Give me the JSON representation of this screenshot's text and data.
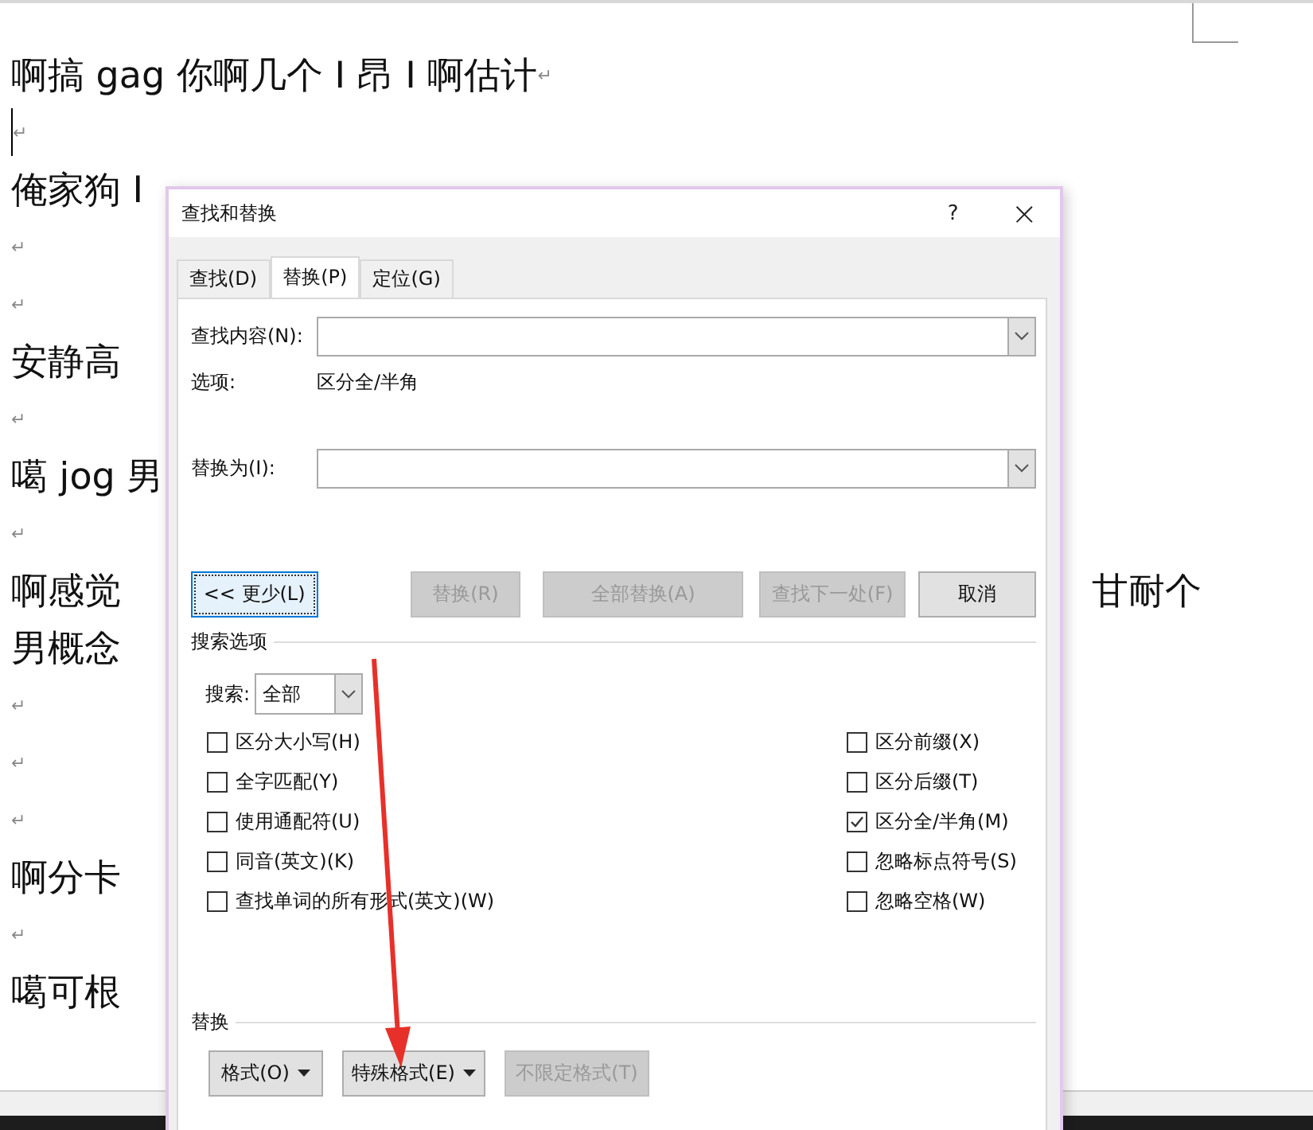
{
  "document": {
    "lines": [
      {
        "text": "啊搞 gag 你啊几个 I 昂 I 啊估计",
        "mark": "↵"
      },
      {
        "mark": "↵",
        "cursor": true
      },
      {
        "text": "俺家狗 I"
      },
      {
        "mark": "↵"
      },
      {
        "mark": "↵"
      },
      {
        "text": "安静高"
      },
      {
        "mark": "↵"
      },
      {
        "text": "噶 jog 男"
      },
      {
        "mark": "↵"
      },
      {
        "text": "啊感觉",
        "right": "甘耐个"
      },
      {
        "text": "男概念"
      },
      {
        "mark": "↵"
      },
      {
        "mark": "↵"
      },
      {
        "mark": "↵"
      },
      {
        "text": "啊分卡"
      },
      {
        "mark": "↵"
      },
      {
        "text": "噶可根"
      }
    ]
  },
  "dialog": {
    "title": "查找和替换",
    "help": "?",
    "close": "×",
    "tabs": [
      {
        "label": "查找(D)",
        "selected": false
      },
      {
        "label": "替换(P)",
        "selected": true
      },
      {
        "label": "定位(G)",
        "selected": false
      }
    ],
    "find": {
      "label": "查找内容(N):"
    },
    "options": {
      "label": "选项:",
      "value": "区分全/半角"
    },
    "replace": {
      "label": "替换为(I):"
    },
    "buttons": [
      {
        "label": "<< 更少(L)",
        "disabled": false,
        "focused": true
      },
      {
        "label": "替换(R)",
        "disabled": true,
        "focused": false
      },
      {
        "label": "全部替换(A)",
        "disabled": true,
        "focused": false
      },
      {
        "label": "查找下一处(F)",
        "disabled": true,
        "focused": false
      },
      {
        "label": "取消",
        "disabled": false,
        "focused": false
      }
    ],
    "search_options": {
      "heading": "搜索选项",
      "search_label": "搜索:",
      "search_value": "全部",
      "left": [
        {
          "label": "区分大小写(H)",
          "checked": false
        },
        {
          "label": "全字匹配(Y)",
          "checked": false
        },
        {
          "label": "使用通配符(U)",
          "checked": false
        },
        {
          "label": "同音(英文)(K)",
          "checked": false
        },
        {
          "label": "查找单词的所有形式(英文)(W)",
          "checked": false
        }
      ],
      "right": [
        {
          "label": "区分前缀(X)",
          "checked": false
        },
        {
          "label": "区分后缀(T)",
          "checked": false
        },
        {
          "label": "区分全/半角(M)",
          "checked": true
        },
        {
          "label": "忽略标点符号(S)",
          "checked": false
        },
        {
          "label": "忽略空格(W)",
          "checked": false
        }
      ]
    },
    "replace_section": {
      "heading": "替换",
      "buttons": [
        {
          "label": "格式(O)",
          "dropdown": true,
          "disabled": false
        },
        {
          "label": "特殊格式(E)",
          "dropdown": true,
          "disabled": false
        },
        {
          "label": "不限定格式(T)",
          "dropdown": false,
          "disabled": true
        }
      ]
    }
  }
}
